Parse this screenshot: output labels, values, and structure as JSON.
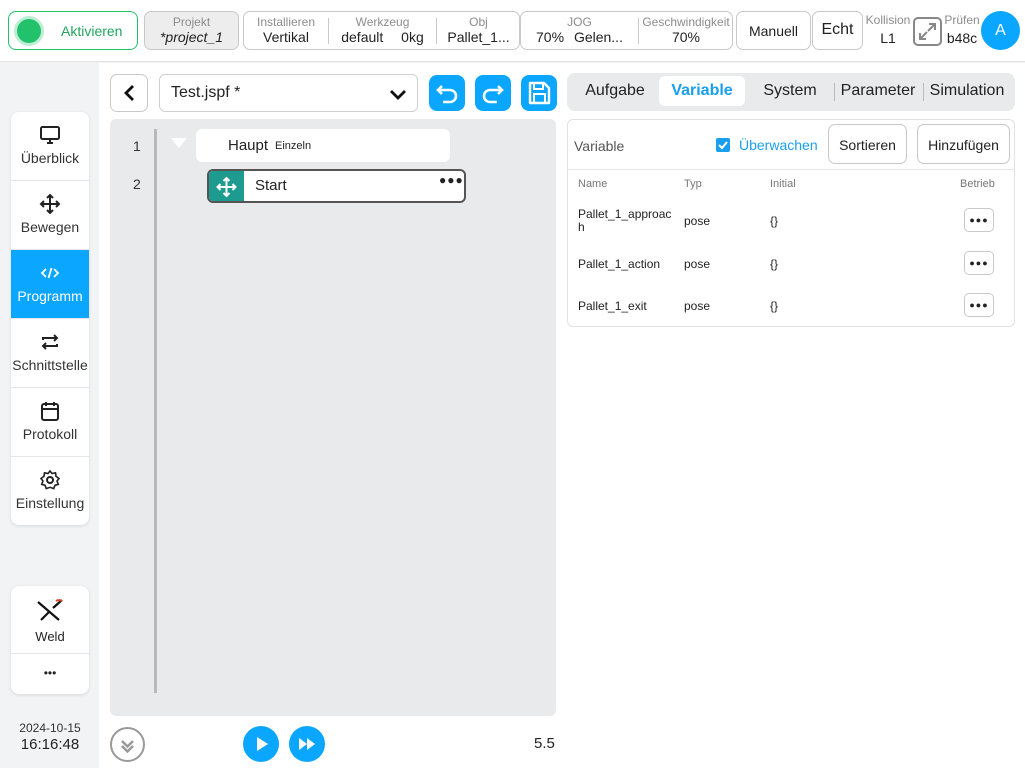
{
  "topbar": {
    "activate_label": "Aktivieren",
    "project": {
      "label": "Projekt",
      "value": "*project_1"
    },
    "install": {
      "label": "Installieren",
      "value": "Vertikal"
    },
    "tool": {
      "label": "Werkzeug",
      "value": "default",
      "load": "0kg"
    },
    "obj": {
      "label": "Obj",
      "value": "Pallet_1..."
    },
    "jog": {
      "label": "JOG",
      "value": "70%",
      "mode": "Gelen..."
    },
    "speed": {
      "label": "Geschwindigkeit",
      "value": "70%"
    },
    "manual_label": "Manuell",
    "real_label": "Echt",
    "collision": {
      "label": "Kollision",
      "value": "L1"
    },
    "check": {
      "label": "Prüfen",
      "value": "b48c"
    },
    "avatar_letter": "A"
  },
  "sidebar": {
    "items": [
      {
        "label": "Überblick",
        "icon": "monitor-icon"
      },
      {
        "label": "Bewegen",
        "icon": "move-icon"
      },
      {
        "label": "Programm",
        "icon": "code-icon",
        "active": true
      },
      {
        "label": "Schnittstelle",
        "icon": "swap-icon"
      },
      {
        "label": "Protokoll",
        "icon": "calendar-icon"
      },
      {
        "label": "Einstellung",
        "icon": "gear-icon"
      }
    ],
    "weld_label": "Weld",
    "more_label": "•••",
    "date": "2024-10-15",
    "time": "16:16:48"
  },
  "editor": {
    "file_name": "Test.jspf *",
    "tree": [
      {
        "line": "1",
        "label": "Haupt",
        "sublabel": "Einzeln"
      },
      {
        "line": "2",
        "label": "Start"
      }
    ],
    "speed_value": "5.5"
  },
  "right_panel": {
    "tabs": [
      "Aufgabe",
      "Variable",
      "System",
      "Parameter",
      "Simulation"
    ],
    "active_tab": "Variable",
    "toolbar": {
      "title": "Variable",
      "monitor_label": "Überwachen",
      "sort_label": "Sortieren",
      "add_label": "Hinzufügen"
    },
    "columns": [
      "Name",
      "Typ",
      "Initial",
      "Betrieb"
    ],
    "rows": [
      {
        "name": "Pallet_1_approach",
        "type": "pose",
        "initial": "{}"
      },
      {
        "name": "Pallet_1_action",
        "type": "pose",
        "initial": "{}"
      },
      {
        "name": "Pallet_1_exit",
        "type": "pose",
        "initial": "{}"
      }
    ]
  },
  "colors": {
    "accent": "#0aa6ff",
    "active_green": "#21c26b",
    "teal": "#1c9b8e"
  }
}
